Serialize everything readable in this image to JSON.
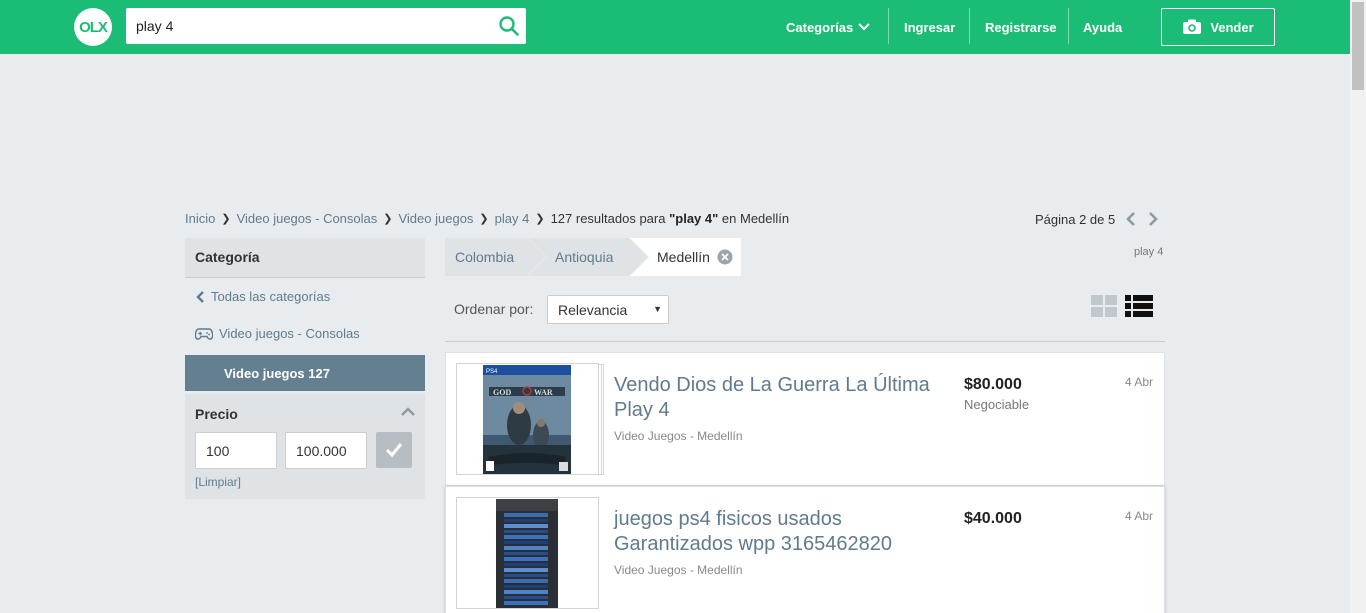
{
  "header": {
    "logo_text": "OLX",
    "search_value": "play 4",
    "nav": {
      "categorias": "Categorías",
      "ingresar": "Ingresar",
      "registrarse": "Registrarse",
      "ayuda": "Ayuda",
      "vender": "Vender"
    },
    "colors": {
      "brand": "#1bbc75"
    }
  },
  "breadcrumb": {
    "items": [
      "Inicio",
      "Video juegos - Consolas",
      "Video juegos",
      "play 4"
    ],
    "results_prefix": "127 resultados para",
    "results_query": "\"play 4\"",
    "results_suffix": "en Medellín"
  },
  "pagination": {
    "label": "Página 2 de 5"
  },
  "sidebar": {
    "category_title": "Categoría",
    "all_categories": "Todas las categorías",
    "parent_category": "Video juegos - Consolas",
    "active_category": "Video juegos 127",
    "price": {
      "title": "Precio",
      "min_value": "100",
      "max_value": "100.000",
      "clear_label": "[Limpiar]"
    }
  },
  "location": {
    "items": [
      "Colombia",
      "Antioquia",
      "Medellín"
    ],
    "search_tag": "play 4"
  },
  "sort": {
    "label": "Ordenar por:",
    "selected": "Relevancia"
  },
  "listings": [
    {
      "title": "Vendo Dios de La Guerra La Última Play 4",
      "category_location": "Video Juegos - Medellín",
      "price": "$80.000",
      "negotiable": "Negociable",
      "date": "4 Abr",
      "image_icon": "god-of-war-cover-image"
    },
    {
      "title": "juegos ps4 fisicos usados Garantizados wpp 3165462820",
      "category_location": "Video Juegos - Medellín",
      "price": "$40.000",
      "negotiable": "",
      "date": "4 Abr",
      "image_icon": "ps4-games-stack-image"
    }
  ]
}
